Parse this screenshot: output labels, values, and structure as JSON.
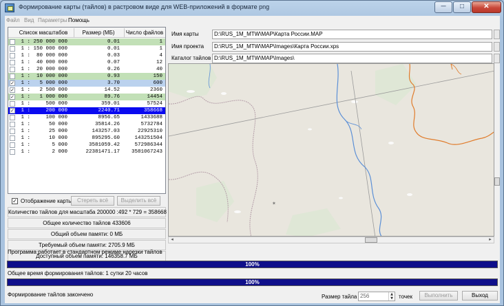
{
  "window": {
    "title": "Формирование карты (тайлов) в растровом виде для WEB-приложений в формате png",
    "min_glyph": "─",
    "max_glyph": "□",
    "close_glyph": "✕"
  },
  "menu": [
    {
      "label": "Файл",
      "enabled": false
    },
    {
      "label": "Вид",
      "enabled": false
    },
    {
      "label": "Параметры",
      "enabled": false
    },
    {
      "label": "Помощь",
      "enabled": true
    }
  ],
  "scale_table": {
    "headers": [
      "Список масштабов",
      "Размер (МБ)",
      "Число файлов"
    ],
    "rows": [
      {
        "checked": false,
        "scale": "1 : 250 000 000",
        "size": "0.01",
        "count": "1",
        "style": "g"
      },
      {
        "checked": false,
        "scale": "1 : 150 000 000",
        "size": "0.01",
        "count": "1",
        "style": ""
      },
      {
        "checked": false,
        "scale": "1 :  80 000 000",
        "size": "0.03",
        "count": "4",
        "style": ""
      },
      {
        "checked": false,
        "scale": "1 :  40 000 000",
        "size": "0.07",
        "count": "12",
        "style": ""
      },
      {
        "checked": false,
        "scale": "1 :  20 000 000",
        "size": "0.26",
        "count": "40",
        "style": ""
      },
      {
        "checked": false,
        "scale": "1 :  10 000 000",
        "size": "0.93",
        "count": "150",
        "style": "g"
      },
      {
        "checked": true,
        "scale": "1 :   5 000 000",
        "size": "3.70",
        "count": "600",
        "style": "b"
      },
      {
        "checked": true,
        "scale": "1 :   2 500 000",
        "size": "14.52",
        "count": "2360",
        "style": ""
      },
      {
        "checked": true,
        "scale": "1 :   1 000 000",
        "size": "89.76",
        "count": "14454",
        "style": "g"
      },
      {
        "checked": false,
        "scale": "1 :     500 000",
        "size": "359.01",
        "count": "57524",
        "style": ""
      },
      {
        "checked": true,
        "scale": "1 :     200 000",
        "size": "2240.71",
        "count": "358668",
        "style": "sel"
      },
      {
        "checked": false,
        "scale": "1 :     100 000",
        "size": "8956.65",
        "count": "1433688",
        "style": ""
      },
      {
        "checked": false,
        "scale": "1 :      50 000",
        "size": "35814.26",
        "count": "5732784",
        "style": ""
      },
      {
        "checked": false,
        "scale": "1 :      25 000",
        "size": "143257.03",
        "count": "22925310",
        "style": ""
      },
      {
        "checked": false,
        "scale": "1 :      10 000",
        "size": "895295.60",
        "count": "143251504",
        "style": ""
      },
      {
        "checked": false,
        "scale": "1 :       5 000",
        "size": "3581059.42",
        "count": "572986344",
        "style": ""
      },
      {
        "checked": false,
        "scale": "1 :       2 000",
        "size": "22381471.17",
        "count": "3581067243",
        "style": ""
      }
    ]
  },
  "controls": {
    "show_map_label": "Отображение карты",
    "show_map_checked": true,
    "erase_all_label": "Стереть всё",
    "select_all_label": "Выделить всё"
  },
  "info": {
    "tiles_for_scale": "Количество тайлов для масштаба 200000 :492 * 729 = 358668",
    "total_tiles": "Общее количество тайлов 433606",
    "total_memory": "Общий объем памяти:   0 МБ",
    "required_memory": "Требуемый объем памяти: 2705.9 МБ",
    "available_memory": "Доступный объем памяти: 146358.7 МБ"
  },
  "fields": {
    "map_name_label": "Имя карты",
    "map_name_value": "D:\\RUS_1M_MTW\\MAP\\Карта России.MAP",
    "project_name_label": "Имя проекта",
    "project_name_value": "D:\\RUS_1M_MTW\\MAP\\Images\\Карта России.xps",
    "tiles_dir_label": "Каталог тайлов",
    "tiles_dir_value": "D:\\RUS_1M_MTW\\MAP\\Images\\"
  },
  "status": {
    "mode_text": "Программа работает в стандартном режиме нарезки тайлов",
    "progress1": 1.0,
    "progress1_text": "100%",
    "total_time": "Общее время формирования тайлов:   1 сутки 20 часов",
    "progress2": 1.0,
    "progress2_text": "100%",
    "done_text": "Формирование тайлов закончено"
  },
  "footer": {
    "tile_size_label": "Размер тайла",
    "tile_size_value": "256",
    "points_label": "точек",
    "run_label": "Выполнить",
    "exit_label": "Выход"
  },
  "map_colors": {
    "land": "#e9e6de",
    "water": "#c8dff0",
    "river": "#5b8fd6",
    "border_orange": "#e07b2a",
    "forest": "#d8e6cf",
    "admin_line": "#a8a8a8"
  }
}
